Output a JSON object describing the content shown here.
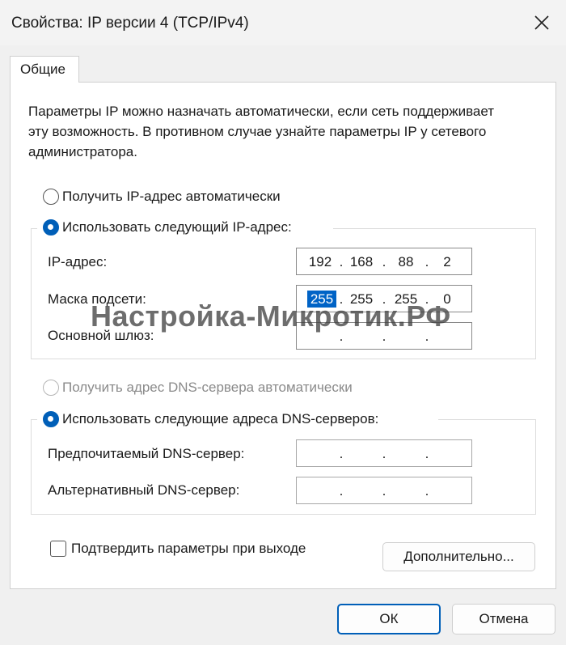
{
  "window": {
    "title": "Свойства: IP версии 4 (TCP/IPv4)"
  },
  "tabs": [
    {
      "label": "Общие",
      "selected": true
    }
  ],
  "description": "Параметры IP можно назначать автоматически, если сеть поддерживает эту возможность. В противном случае узнайте параметры IP у сетевого администратора.",
  "ip_section": {
    "auto_label": "Получить IP-адрес автоматически",
    "manual_label": "Использовать следующий IP-адрес:",
    "selected": "manual",
    "ip_address_label": "IP-адрес:",
    "ip_address": [
      "192",
      "168",
      "88",
      "2"
    ],
    "subnet_label": "Маска подсети:",
    "subnet_mask": [
      "255",
      "255",
      "255",
      "0"
    ],
    "gateway_label": "Основной шлюз:",
    "gateway": [
      "",
      "",
      "",
      ""
    ]
  },
  "dns_section": {
    "auto_label": "Получить адрес DNS-сервера автоматически",
    "manual_label": "Использовать следующие адреса DNS-серверов:",
    "selected": "manual",
    "preferred_label": "Предпочитаемый DNS-сервер:",
    "preferred": [
      "",
      "",
      "",
      ""
    ],
    "alternate_label": "Альтернативный DNS-сервер:",
    "alternate": [
      "",
      "",
      "",
      ""
    ]
  },
  "validate_on_exit": {
    "label": "Подтвердить параметры при выходе",
    "checked": false
  },
  "buttons": {
    "advanced": "Дополнительно...",
    "ok": "ОК",
    "cancel": "Отмена"
  },
  "watermark": "Настройка-Микротик.РФ",
  "colors": {
    "accent": "#005fb8",
    "selection": "#0063c6"
  }
}
